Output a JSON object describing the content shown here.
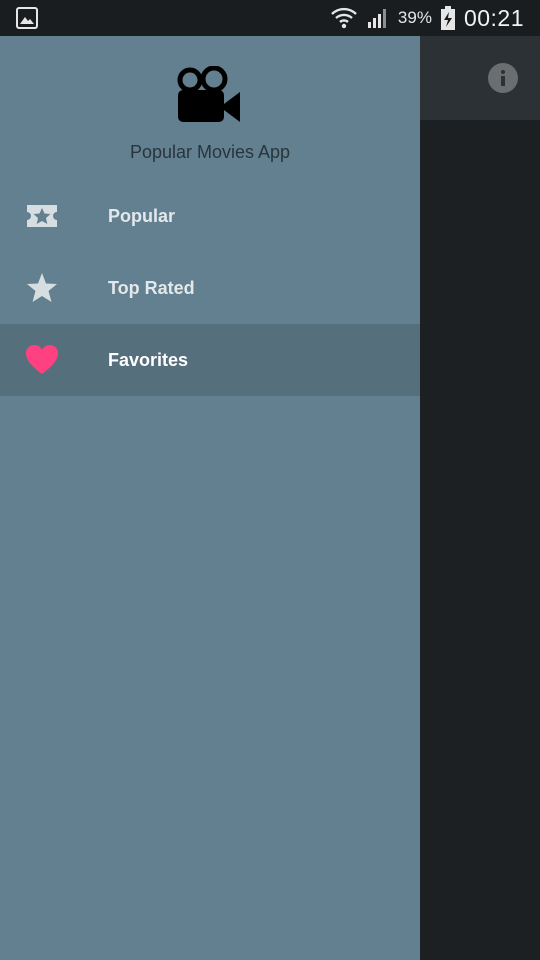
{
  "status_bar": {
    "battery_percent": "39%",
    "time": "00:21",
    "icons": [
      "gallery-icon",
      "wifi-icon",
      "cell-signal-icon",
      "battery-charging-icon"
    ]
  },
  "app_toolbar": {
    "icons": [
      "info-icon"
    ]
  },
  "drawer": {
    "header": {
      "logo_icon": "movie-camera-icon",
      "app_name": "Popular Movies App"
    },
    "items": [
      {
        "label": "Popular",
        "icon": "ticket-star-icon",
        "selected": false
      },
      {
        "label": "Top Rated",
        "icon": "star-icon",
        "selected": false
      },
      {
        "label": "Favorites",
        "icon": "heart-icon",
        "selected": true
      }
    ]
  },
  "colors": {
    "drawer_bg": "#62808f",
    "selected_item_bg": "#566f7c",
    "heart": "#ff4081",
    "scrim": "#1c2023"
  }
}
